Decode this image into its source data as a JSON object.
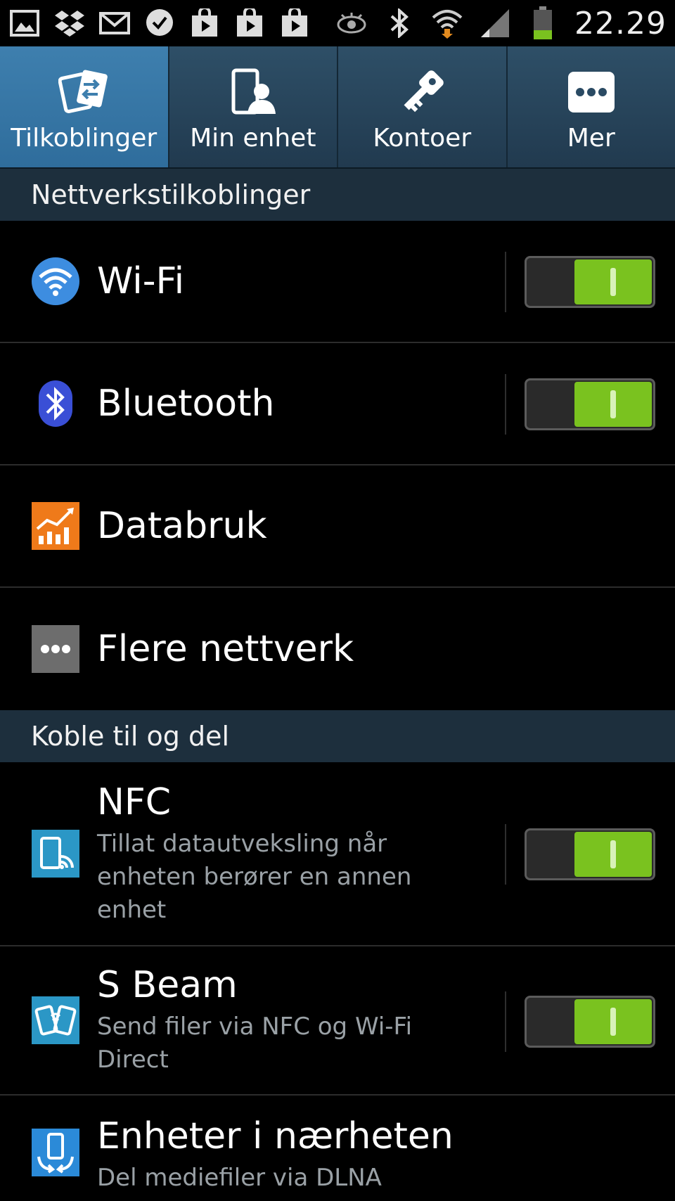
{
  "status_bar": {
    "time": "22.29",
    "icons": [
      "gallery-icon",
      "dropbox-icon",
      "gmail-icon",
      "messenger-icon",
      "play-store-icon",
      "play-store-icon",
      "play-store-icon",
      "eye-icon",
      "bluetooth-icon",
      "wifi-icon",
      "signal-icon",
      "battery-icon"
    ]
  },
  "tabs": [
    {
      "label": "Tilkoblinger",
      "icon": "connections-icon",
      "active": true
    },
    {
      "label": "Min enhet",
      "icon": "my-device-icon",
      "active": false
    },
    {
      "label": "Kontoer",
      "icon": "key-icon",
      "active": false
    },
    {
      "label": "Mer",
      "icon": "more-icon",
      "active": false
    }
  ],
  "sections": [
    {
      "title": "Nettverkstilkoblinger"
    },
    {
      "title": "Koble til og del"
    }
  ],
  "items": [
    {
      "title": "Wi-Fi",
      "subtitle": "",
      "icon": "wifi-icon",
      "toggle": true,
      "on": true
    },
    {
      "title": "Bluetooth",
      "subtitle": "",
      "icon": "bluetooth-icon",
      "toggle": true,
      "on": true
    },
    {
      "title": "Databruk",
      "subtitle": "",
      "icon": "data-usage-icon",
      "toggle": false
    },
    {
      "title": "Flere nettverk",
      "subtitle": "",
      "icon": "more-networks-icon",
      "toggle": false
    },
    {
      "title": "NFC",
      "subtitle": "Tillat datautveksling når enheten berører en annen enhet",
      "icon": "nfc-icon",
      "toggle": true,
      "on": true
    },
    {
      "title": "S Beam",
      "subtitle": "Send filer via NFC og Wi-Fi Direct",
      "icon": "s-beam-icon",
      "toggle": true,
      "on": true
    },
    {
      "title": "Enheter i nærheten",
      "subtitle": "Del mediefiler via DLNA",
      "icon": "nearby-devices-icon",
      "toggle": false
    }
  ],
  "colors": {
    "accent": "#7ac21f",
    "tab_active": "#3e7fae",
    "section_bg": "#1d2f3d"
  }
}
